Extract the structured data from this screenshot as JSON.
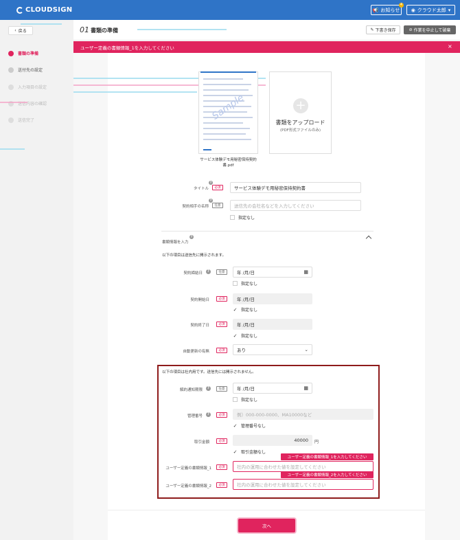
{
  "app": {
    "logo": "CLOUDSIGN"
  },
  "topbar": {
    "notifications_label": "お知らせ",
    "notifications_badge": "4",
    "user_label": "クラウド太郎"
  },
  "sidebar": {
    "back_label": "戻る",
    "steps": [
      {
        "label": "書類の準備"
      },
      {
        "label": "送付先の設定"
      },
      {
        "label": "入力項目の設定"
      },
      {
        "label": "送信内容の確認"
      },
      {
        "label": "送信完了"
      }
    ]
  },
  "header": {
    "step_number": "01",
    "title": "書類の準備",
    "draft_label": "下書き保存",
    "cancel_label": "作業を中止して破棄"
  },
  "error_banner": {
    "message": "ユーザー定義の書類情報_1を入力してください",
    "close": "×"
  },
  "document": {
    "thumbnail_watermark": "Sample",
    "file_name": "サービス体験デモ用秘密保持契約書.pdf"
  },
  "upload": {
    "icon": "+",
    "label": "書類をアップロード",
    "sublabel": "(PDF形式ファイルのみ)"
  },
  "badges": {
    "required": "必須",
    "optional": "任意"
  },
  "help_icon_glyph": "?",
  "form": {
    "title": {
      "label": "タイトル",
      "value": "サービス体験デモ用秘密保持契約書"
    },
    "counterparty": {
      "label": "契約相手の名称",
      "placeholder": "送信先の会社名などを入力してください",
      "checkbox": "指定なし"
    }
  },
  "doc_info": {
    "title": "書類情報を入力",
    "public_note": "以下の項目は送信先に開示されます。",
    "contract_date": {
      "label": "契約締結日",
      "value": "年 /月/日",
      "checkbox": "指定なし"
    },
    "start_date": {
      "label": "契約開始日",
      "value": "年 /月/日",
      "checkbox": "指定なし"
    },
    "end_date": {
      "label": "契約終了日",
      "value": "年 /月/日",
      "checkbox": "指定なし"
    },
    "auto_renewal": {
      "label": "自動更新の有無",
      "value": "あり"
    },
    "internal_note": "以下の項目は社内用です。送信先には開示されません。",
    "termination_notice": {
      "label": "解約通知期限",
      "value": "年 /月/日",
      "checkbox": "指定なし"
    },
    "control_number": {
      "label": "管理番号",
      "placeholder": "例）000-000-0000、MA10000など",
      "checkbox": "管理番号なし"
    },
    "amount": {
      "label": "取引金額",
      "value": "40000",
      "unit": "円",
      "checkbox": "取引金額なし"
    },
    "user_field_1": {
      "label": "ユーザー定義の書類情報_1",
      "placeholder": "社内の運用に合わせた値を設定してください",
      "tooltip": "ユーザー定義の書類情報_1を入力してください"
    },
    "user_field_2": {
      "label": "ユーザー定義の書類情報_2",
      "placeholder": "社内の運用に合わせた値を設定してください",
      "tooltip": "ユーザー定義の書類情報_2を入力してください"
    }
  },
  "next_button": "次へ"
}
